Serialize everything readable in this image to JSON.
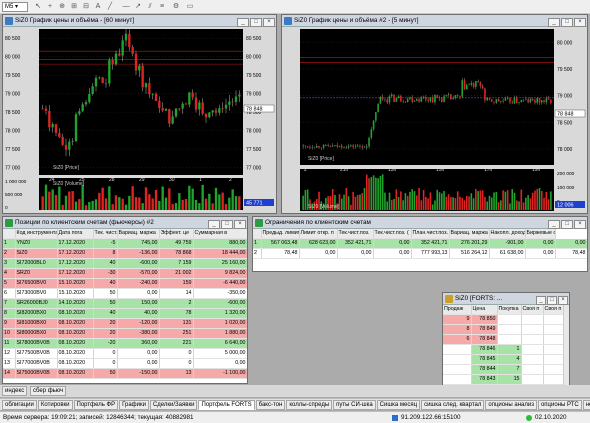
{
  "toolbar": {
    "interval": "M5"
  },
  "win1": {
    "title": "SiZ0 График цены и объёма - [60 минут]",
    "price_axis": [
      "80 500",
      "80 000",
      "79 500",
      "79 000",
      "78 500",
      "78 000",
      "77 500",
      "77 000"
    ],
    "current_price": "78 848",
    "vol_axis": [
      "1 000 000",
      "500 000",
      "0"
    ],
    "vol_badge": "45 771",
    "dates": [
      "24",
      "25",
      "28",
      "29",
      "30",
      "1",
      "2"
    ],
    "legend_price": "SiZ0 [Price]",
    "legend_vol": "SiZ0 [Volume]"
  },
  "win2": {
    "title": "SiZ0 График цены и объёма #2 - [5 минут]",
    "price_axis": [
      "80 000",
      "79 500",
      "79 000",
      "78 500",
      "78 000"
    ],
    "current_price": "78 848",
    "vol_axis": [
      "200 000",
      "100 000",
      "0"
    ],
    "vol_badge": "12 006",
    "times": [
      "21h",
      "13h",
      "15h",
      "17h",
      "19h"
    ],
    "day_label": "2",
    "legend_price": "SiZ0 [Price]",
    "legend_vol": "SiZ0 [Volume]"
  },
  "positions": {
    "title": "Позиции по клиентским счетам (фьючерсы) #2",
    "headers": [
      "",
      "Код инструмента",
      "Дата пога",
      "Тек. чист.",
      "Вариац. маржа",
      "Эффект. це",
      "Суммарная в"
    ],
    "rows": [
      [
        "1",
        "YNZ0",
        "17.12.2020",
        "-5",
        "745,00",
        "49 759",
        "880,00",
        "g"
      ],
      [
        "2",
        "SiZ0",
        "17.12.2020",
        "8",
        "-136,00",
        "78 868",
        "18 444,00",
        "r"
      ],
      [
        "3",
        "SI72000BL0",
        "17.12.2020",
        "40",
        "-600,00",
        "7 159",
        "25 160,00",
        "g"
      ],
      [
        "4",
        "SRZ0",
        "17.12.2020",
        "-30",
        "-570,00",
        "21 002",
        "9 824,00",
        "r"
      ],
      [
        "5",
        "SI76500BV0",
        "15.10.2020",
        "40",
        "-240,00",
        "159",
        "-6 440,00",
        "r"
      ],
      [
        "6",
        "SI73000BV0",
        "15.10.2020",
        "50",
        "0,00",
        "14",
        "-350,00",
        "w"
      ],
      [
        "7",
        "SR26000BJ0",
        "14.10.2020",
        "50",
        "150,00",
        "2",
        "-600,00",
        "g"
      ],
      [
        "8",
        "SI82000BX0",
        "08.10.2020",
        "40",
        "40,00",
        "78",
        "1 320,00",
        "g"
      ],
      [
        "9",
        "SI81000BX0",
        "08.10.2020",
        "20",
        "-120,00",
        "131",
        "1 020,00",
        "r"
      ],
      [
        "10",
        "SI80000BX0",
        "08.10.2020",
        "20",
        "-380,00",
        "251",
        "1 880,00",
        "r"
      ],
      [
        "11",
        "SI78000BV0B",
        "08.10.2020",
        "-20",
        "360,00",
        "221",
        "6 640,00",
        "g"
      ],
      [
        "12",
        "SI77500BV0B",
        "08.10.2020",
        "0",
        "0,00",
        "0",
        "5 000,00",
        "w"
      ],
      [
        "13",
        "SI77000BV0B",
        "08.10.2020",
        "0",
        "0,00",
        "0",
        "0,00",
        "w"
      ],
      [
        "14",
        "SI75000BV0B",
        "08.10.2020",
        "50",
        "-150,00",
        "13",
        "-1 100,00",
        "r"
      ]
    ],
    "tabs": [
      "индекс",
      "сбер фьюч"
    ]
  },
  "limits": {
    "title": "Ограничения по клиентским счетам",
    "headers": [
      "",
      "Предыд. лимит",
      "Лимит откр. п",
      "Тек.чист.поз.",
      "Тек.чист.поз. (",
      "План.чист.поз.",
      "Вариац. маржа",
      "Накопл. доход",
      "Биржевые с"
    ],
    "rows": [
      [
        "1",
        "567 063,48",
        "628 623,00",
        "352 421,71",
        "0,00",
        "352 421,71",
        "276 201,29",
        "-901,00",
        "0,00",
        "0,00",
        "g"
      ],
      [
        "2",
        "78,48",
        "0,00",
        "0,00",
        "0,00",
        "777 993,13",
        "516 264,12",
        "61 638,00",
        "0,00",
        "78,48",
        "w"
      ]
    ]
  },
  "orderbook": {
    "title": "SiZ0 [FORTS: ...",
    "headers": [
      "Продаж",
      "Цена",
      "Покупка",
      "Своя п",
      "Своя п"
    ],
    "sell": [
      [
        "9",
        "78 850",
        ""
      ],
      [
        "8",
        "78 849",
        ""
      ],
      [
        "6",
        "78 848",
        ""
      ]
    ],
    "buy": [
      [
        "",
        "78 846",
        "1"
      ],
      [
        "",
        "78 845",
        "4"
      ],
      [
        "",
        "78 844",
        "7"
      ],
      [
        "",
        "78 843",
        "15"
      ]
    ]
  },
  "bottom_tabs": [
    "облигации",
    "Котировки",
    "Портфель ФР",
    "Графики",
    "Сделки/Заявки",
    "Портфель FORTS",
    "бакс-тон",
    "коллы-спреды",
    "путы СИ-шка",
    "Сишка месяц",
    "сишка след. квартал",
    "опционы анализ",
    "опционы РТС",
    "нефть-"
  ],
  "status": {
    "server_time": "Время сервера: 19:09:21; записей: 12846344; текущая: 40882981",
    "connection": "91.209.122.66:15100",
    "date": "02.10.2020"
  },
  "colors": {
    "green_row": "#a7e3a7",
    "red_row": "#f5a9a9",
    "chart_bg": "#000000"
  }
}
